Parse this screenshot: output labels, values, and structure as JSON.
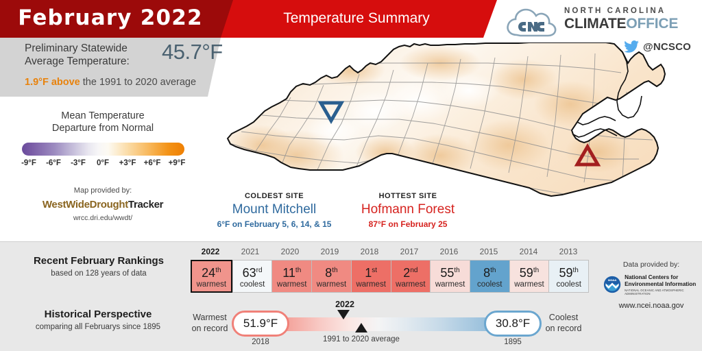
{
  "header": {
    "month_year": "February 2022",
    "summary_title": "Temperature Summary",
    "dark_red": "#9c0a0a",
    "bright_red": "#d60d0d"
  },
  "logo": {
    "line_small": "NORTH CAROLINA",
    "word_climate": "CLIMATE",
    "word_office": "OFFICE",
    "twitter_handle": "@NCSCO",
    "twitter_color": "#55acee"
  },
  "temperature": {
    "label_line1": "Preliminary Statewide",
    "label_line2": "Average Temperature:",
    "value": "45.7°F",
    "departure_accent": "1.9°F above",
    "departure_rest": " the 1991 to 2020 average",
    "accent_color": "#e8820c",
    "value_color": "#4a6170"
  },
  "legend": {
    "title_line1": "Mean Temperature",
    "title_line2": "Departure from Normal",
    "ticks": [
      "-9°F",
      "-6°F",
      "-3°F",
      "0°F",
      "+3°F",
      "+6°F",
      "+9°F"
    ],
    "color_cold": "#6a4b9c",
    "color_mid": "#f7f6f7",
    "color_warm": "#ef7f02"
  },
  "map_credit": {
    "lead": "Map provided by:",
    "name_part1": "WestWideDrought",
    "name_part2": "Tracker",
    "url": "wrcc.dri.edu/wwdt/"
  },
  "sites": {
    "coldest": {
      "kicker": "COLDEST SITE",
      "name": "Mount Mitchell",
      "detail": "6°F on February 5, 6, 14, & 15",
      "color": "#2f6a9e",
      "marker": "down-triangle"
    },
    "hottest": {
      "kicker": "HOTTEST SITE",
      "name": "Hofmann Forest",
      "detail": "87°F on February 25",
      "color": "#d6231f",
      "marker": "up-triangle"
    }
  },
  "rankings": {
    "title": "Recent February Rankings",
    "subtitle": "based on 128 years of data",
    "years": [
      "2022",
      "2021",
      "2020",
      "2019",
      "2018",
      "2017",
      "2016",
      "2015",
      "2014",
      "2013"
    ],
    "cells": [
      {
        "rank": "24",
        "suffix": "th",
        "word": "warmest",
        "color": "#f0948c",
        "current": true
      },
      {
        "rank": "63",
        "suffix": "rd",
        "word": "coolest",
        "color": "#f4f7f9",
        "current": false
      },
      {
        "rank": "11",
        "suffix": "th",
        "word": "warmest",
        "color": "#f08a82",
        "current": false
      },
      {
        "rank": "8",
        "suffix": "th",
        "word": "warmest",
        "color": "#f08a82",
        "current": false
      },
      {
        "rank": "1",
        "suffix": "st",
        "word": "warmest",
        "color": "#ed6f66",
        "current": false
      },
      {
        "rank": "2",
        "suffix": "nd",
        "word": "warmest",
        "color": "#ed6f66",
        "current": false
      },
      {
        "rank": "55",
        "suffix": "th",
        "word": "warmest",
        "color": "#f7dcd8",
        "current": false
      },
      {
        "rank": "8",
        "suffix": "th",
        "word": "coolest",
        "color": "#63a3cd",
        "current": false
      },
      {
        "rank": "59",
        "suffix": "th",
        "word": "warmest",
        "color": "#f7e2de",
        "current": false
      },
      {
        "rank": "59",
        "suffix": "th",
        "word": "coolest",
        "color": "#e8f0f5",
        "current": false
      }
    ]
  },
  "historical": {
    "title": "Historical Perspective",
    "subtitle": "comparing all Februarys since 1895",
    "warmest_label_l1": "Warmest",
    "warmest_label_l2": "on record",
    "coolest_label_l1": "Coolest",
    "coolest_label_l2": "on record",
    "warmest_value": "51.9°F",
    "warmest_year": "2018",
    "coolest_value": "30.8°F",
    "coolest_year": "1895",
    "marker_current_label": "2022",
    "marker_avg_label": "1991 to 2020 average",
    "warm_color": "#f08078",
    "cool_color": "#6aa6cf"
  },
  "noaa": {
    "lead": "Data provided by:",
    "name_line1": "National Centers for",
    "name_line2": "Environmental Information",
    "agency": "NATIONAL OCEANIC AND ATMOSPHERIC ADMINISTRATION",
    "url": "www.ncei.noaa.gov",
    "badge_color": "#1d5fa8"
  },
  "chart_data": {
    "type": "map",
    "title": "Mean Temperature Departure from Normal — North Carolina, February 2022",
    "colorbar": {
      "ticks": [
        -9,
        -6,
        -3,
        0,
        3,
        6,
        9
      ],
      "unit": "°F",
      "low_color": "#6a4b9c",
      "mid_color": "#ffffff",
      "high_color": "#ef7f02"
    },
    "statewide_average_f": 45.7,
    "departure_f": 1.9,
    "rank_of_128": 24,
    "rank_direction": "warmest",
    "markers": [
      {
        "name": "Mount Mitchell",
        "role": "coldest",
        "value_f": 6,
        "dates": "February 5, 6, 14, & 15"
      },
      {
        "name": "Hofmann Forest",
        "role": "hottest",
        "value_f": 87,
        "dates": "February 25"
      }
    ],
    "rankings_series": {
      "years": [
        2022,
        2021,
        2020,
        2019,
        2018,
        2017,
        2016,
        2015,
        2014,
        2013
      ],
      "ranks": [
        24,
        63,
        11,
        8,
        1,
        2,
        55,
        8,
        59,
        59
      ],
      "directions": [
        "warmest",
        "coolest",
        "warmest",
        "warmest",
        "warmest",
        "warmest",
        "warmest",
        "coolest",
        "warmest",
        "coolest"
      ]
    },
    "historical_scale": {
      "warmest_f": 51.9,
      "warmest_year": 2018,
      "coolest_f": 30.8,
      "coolest_year": 1895,
      "current_f": 45.7,
      "normal_f": 43.8
    }
  }
}
